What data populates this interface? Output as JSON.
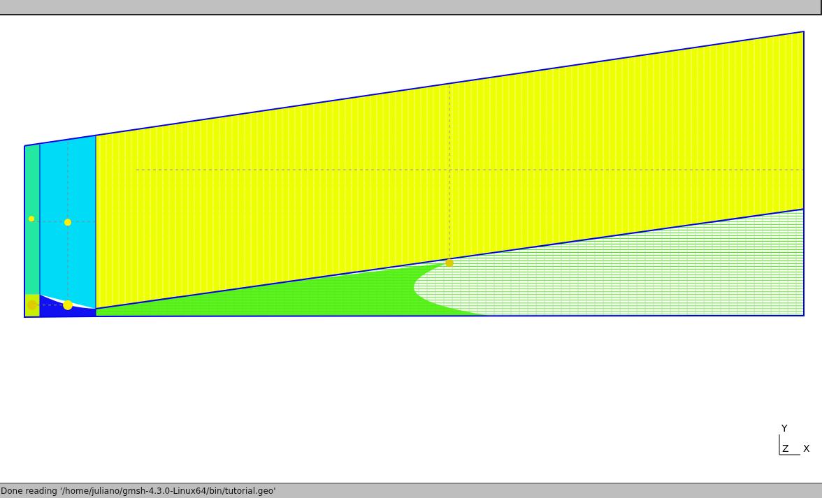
{
  "axes": {
    "y": "Y",
    "z": "Z",
    "x": "X"
  },
  "status_bar": "Done reading '/home/juliano/gmsh-4.3.0-Linux64/bin/tutorial.geo'"
}
